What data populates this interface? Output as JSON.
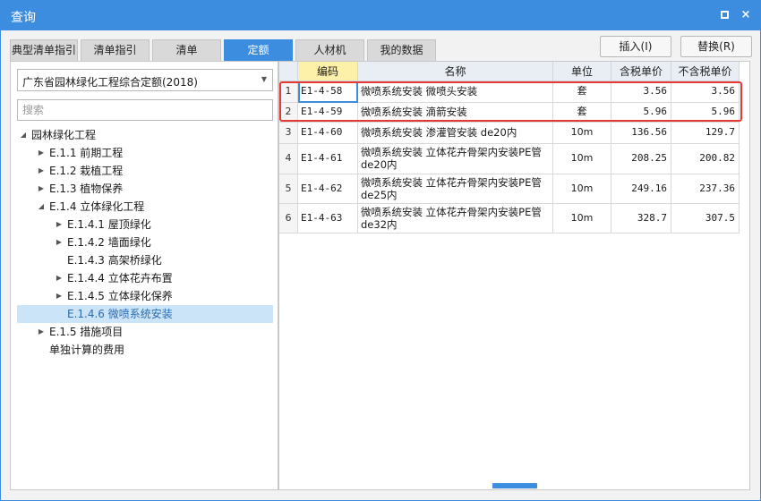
{
  "window": {
    "title": "查询",
    "maximize_icon": "maximize-icon",
    "close_icon": "close-icon",
    "close_glyph": "×"
  },
  "tabs": [
    {
      "label": "典型清单指引",
      "active": false
    },
    {
      "label": "清单指引",
      "active": false
    },
    {
      "label": "清单",
      "active": false
    },
    {
      "label": "定额",
      "active": true
    },
    {
      "label": "人材机",
      "active": false
    },
    {
      "label": "我的数据",
      "active": false
    }
  ],
  "actions": {
    "insert": "插入(I)",
    "replace": "替换(R)"
  },
  "library": {
    "selected": "广东省园林绿化工程综合定额(2018)"
  },
  "search": {
    "placeholder": "搜索",
    "value": ""
  },
  "tree": [
    {
      "label": "园林绿化工程",
      "caret": "◢"
    },
    {
      "label": "E.1.1 前期工程",
      "caret": "▶"
    },
    {
      "label": "E.1.2 栽植工程",
      "caret": "▶"
    },
    {
      "label": "E.1.3 植物保养",
      "caret": "▶"
    },
    {
      "label": "E.1.4 立体绿化工程",
      "caret": "◢"
    },
    {
      "label": "E.1.4.1 屋顶绿化",
      "caret": "▶"
    },
    {
      "label": "E.1.4.2 墙面绿化",
      "caret": "▶"
    },
    {
      "label": "E.1.4.3 高架桥绿化",
      "caret": ""
    },
    {
      "label": "E.1.4.4 立体花卉布置",
      "caret": "▶"
    },
    {
      "label": "E.1.4.5 立体绿化保养",
      "caret": "▶"
    },
    {
      "label": "E.1.4.6 微喷系统安装",
      "caret": "",
      "selected": true
    },
    {
      "label": "E.1.5 措施项目",
      "caret": "▶"
    },
    {
      "label": "单独计算的费用",
      "caret": ""
    }
  ],
  "table": {
    "columns": [
      "",
      "编码",
      "名称",
      "单位",
      "含税单价",
      "不含税单价"
    ],
    "rows": [
      {
        "idx": "1",
        "code": "E1-4-58",
        "name": "微喷系统安装 微喷头安装",
        "unit": "套",
        "price_tax": "3.56",
        "price_notax": "3.56"
      },
      {
        "idx": "2",
        "code": "E1-4-59",
        "name": "微喷系统安装 滴箭安装",
        "unit": "套",
        "price_tax": "5.96",
        "price_notax": "5.96"
      },
      {
        "idx": "3",
        "code": "E1-4-60",
        "name": "微喷系统安装 渗灌管安装 de20内",
        "unit": "10m",
        "price_tax": "136.56",
        "price_notax": "129.7"
      },
      {
        "idx": "4",
        "code": "E1-4-61",
        "name": "微喷系统安装 立体花卉骨架内安装PE管 de20内",
        "unit": "10m",
        "price_tax": "208.25",
        "price_notax": "200.82"
      },
      {
        "idx": "5",
        "code": "E1-4-62",
        "name": "微喷系统安装 立体花卉骨架内安装PE管 de25内",
        "unit": "10m",
        "price_tax": "249.16",
        "price_notax": "237.36"
      },
      {
        "idx": "6",
        "code": "E1-4-63",
        "name": "微喷系统安装 立体花卉骨架内安装PE管 de32内",
        "unit": "10m",
        "price_tax": "328.7",
        "price_notax": "307.5"
      }
    ]
  },
  "colors": {
    "accent": "#3c8de0",
    "highlight_border": "#e53935",
    "selected_header": "#fdf0a8"
  }
}
